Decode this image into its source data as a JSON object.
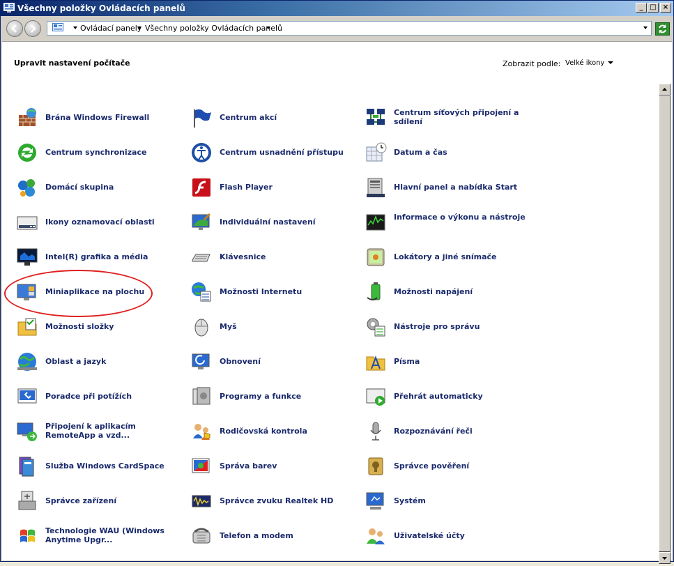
{
  "window": {
    "title": "Všechny položky Ovládacích panelů"
  },
  "address": {
    "crumbs": [
      "Ovládací panely",
      "Všechny položky Ovládacích panelů"
    ]
  },
  "header": {
    "heading": "Upravit nastavení počítače",
    "view_label": "Zobrazit podle:",
    "view_value": "Velké ikony"
  },
  "items": [
    {
      "label": "Brána Windows Firewall",
      "icon": "firewall-icon"
    },
    {
      "label": "Centrum akcí",
      "icon": "action-center-flag-icon"
    },
    {
      "label": "Centrum síťových připojení a sdílení",
      "icon": "network-center-icon"
    },
    {
      "label": "Centrum synchronizace",
      "icon": "sync-center-icon"
    },
    {
      "label": "Centrum usnadnění přístupu",
      "icon": "ease-of-access-icon"
    },
    {
      "label": "Datum a čas",
      "icon": "date-time-icon"
    },
    {
      "label": "Domácí skupina",
      "icon": "homegroup-icon"
    },
    {
      "label": "Flash Player",
      "icon": "flash-player-icon"
    },
    {
      "label": "Hlavní panel a nabídka Start",
      "icon": "taskbar-start-icon"
    },
    {
      "label": "Ikony oznamovací oblasti",
      "icon": "notification-icons-icon"
    },
    {
      "label": "Individuální nastavení",
      "icon": "personalization-icon"
    },
    {
      "label": "Informace o výkonu a nástroje",
      "icon": "performance-icon"
    },
    {
      "label": "Intel(R) grafika a média",
      "icon": "intel-graphics-icon"
    },
    {
      "label": "Klávesnice",
      "icon": "keyboard-icon"
    },
    {
      "label": "Lokátory a jiné snímače",
      "icon": "location-sensors-icon"
    },
    {
      "label": "Miniaplikace na plochu",
      "icon": "desktop-gadgets-icon"
    },
    {
      "label": "Možnosti Internetu",
      "icon": "internet-options-icon"
    },
    {
      "label": "Možnosti napájení",
      "icon": "power-options-icon"
    },
    {
      "label": "Možnosti složky",
      "icon": "folder-options-icon"
    },
    {
      "label": "Myš",
      "icon": "mouse-icon"
    },
    {
      "label": "Nástroje pro správu",
      "icon": "admin-tools-icon"
    },
    {
      "label": "Oblast a jazyk",
      "icon": "region-language-icon"
    },
    {
      "label": "Obnovení",
      "icon": "recovery-icon"
    },
    {
      "label": "Písma",
      "icon": "fonts-icon"
    },
    {
      "label": "Poradce při potížích",
      "icon": "troubleshooting-icon"
    },
    {
      "label": "Programy a funkce",
      "icon": "programs-features-icon"
    },
    {
      "label": "Přehrát automaticky",
      "icon": "autoplay-icon"
    },
    {
      "label": "Připojení k aplikacím RemoteApp a vzd...",
      "icon": "remoteapp-icon"
    },
    {
      "label": "Rodičovská kontrola",
      "icon": "parental-controls-icon"
    },
    {
      "label": "Rozpoznávání řeči",
      "icon": "speech-recognition-icon"
    },
    {
      "label": "Služba Windows CardSpace",
      "icon": "cardspace-icon"
    },
    {
      "label": "Správa barev",
      "icon": "color-management-icon"
    },
    {
      "label": "Správce pověření",
      "icon": "credential-manager-icon"
    },
    {
      "label": "Správce zařízení",
      "icon": "device-manager-icon"
    },
    {
      "label": "Správce zvuku Realtek HD",
      "icon": "realtek-audio-icon"
    },
    {
      "label": "Systém",
      "icon": "system-icon"
    },
    {
      "label": "Technologie WAU (Windows Anytime Upgr...",
      "icon": "windows-anytime-upgrade-icon"
    },
    {
      "label": "Telefon a modem",
      "icon": "phone-modem-icon"
    },
    {
      "label": "Uživatelské účty",
      "icon": "user-accounts-icon"
    }
  ]
}
